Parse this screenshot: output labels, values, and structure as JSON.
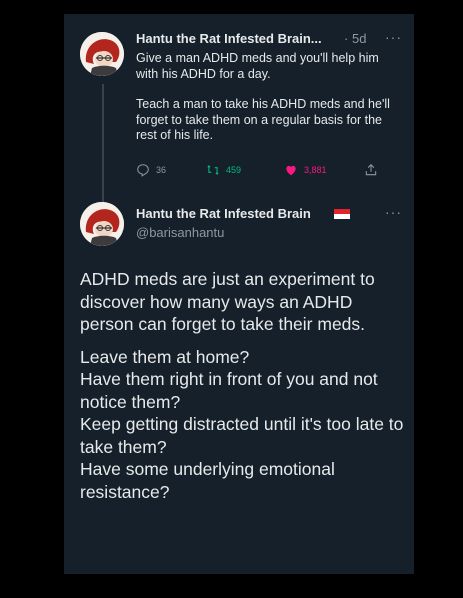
{
  "reply_tweet": {
    "author_name": "Hantu the Rat Infested Brain...",
    "time_separator": "·",
    "time": "5d",
    "more_icon": "···",
    "paragraphs": [
      "Give a man ADHD meds and you'll help him with his ADHD for a day.",
      "Teach a man to take his ADHD meds and he'll forget to take them on a regular basis for the rest of his life."
    ],
    "reply_count": "36",
    "retweet_count": "459",
    "like_count": "3,881",
    "colors": {
      "reply": "#8b98a5",
      "retweet": "#00ba7c",
      "like": "#f91880"
    }
  },
  "main_tweet": {
    "author_name": "Hantu the Rat Infested Brain",
    "handle": "@barisanhantu",
    "more_icon": "···",
    "flag_icon": "indonesia-flag-icon",
    "paragraphs": [
      "ADHD meds are just an experiment to discover how many ways an ADHD person can forget to take their meds.",
      "Leave them at home?\nHave them right in front of you and not notice them?\nKeep getting distracted until it's too late to take them?\nHave some underlying emotional resistance?"
    ]
  }
}
